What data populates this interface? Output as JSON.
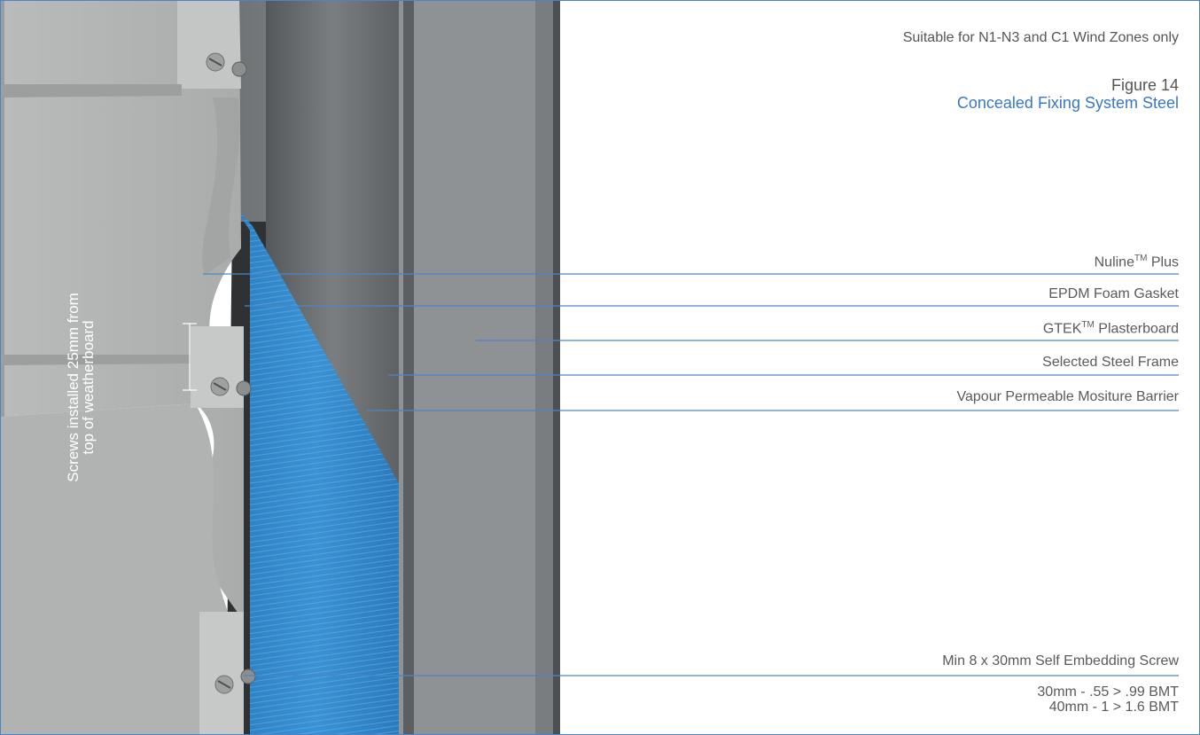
{
  "note": "Suitable for N1-N3 and C1 Wind Zones only",
  "figure": {
    "number": "Figure 14",
    "title": "Concealed Fixing System Steel"
  },
  "labels": {
    "nuline": {
      "name": "Nuline",
      "tm": "TM",
      "suffix": " Plus"
    },
    "gasket": "EPDM Foam Gasket",
    "gtek": {
      "name": "GTEK",
      "tm": "TM",
      "suffix": " Plasterboard"
    },
    "frame": "Selected Steel Frame",
    "barrier": "Vapour Permeable Mositure Barrier",
    "screw": "Min 8 x 30mm Self Embedding Screw"
  },
  "screw_spec": {
    "line1": "30mm - .55 > .99 BMT",
    "line2": "40mm - 1 > 1.6 BMT"
  },
  "screw_note": "Screws installed 25mm from top of weatherboard",
  "colors": {
    "accent": "#3a78c2",
    "leader": "#4a86c6",
    "board": "#b4b7b6",
    "frame": "#6f7273",
    "barrier": "#2f86c8"
  }
}
